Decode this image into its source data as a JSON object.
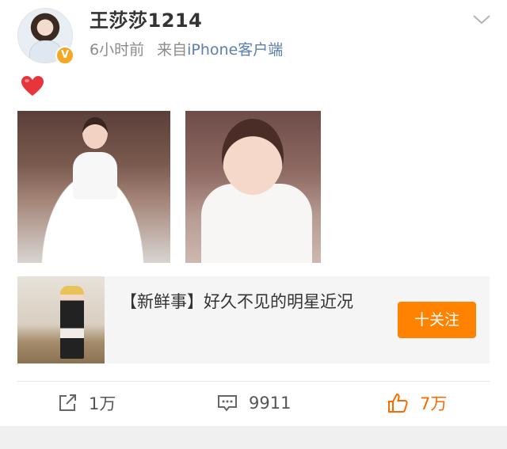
{
  "post": {
    "username": "王莎莎1214",
    "time": "6小时前",
    "source_prefix": "来自",
    "source": "iPhone客户端",
    "content_icon": "red-heart-emoji",
    "verified_icon": "verified-v-badge",
    "images": [
      "photo-1",
      "photo-2"
    ]
  },
  "card": {
    "title": "【新鲜事】好久不见的明星近况",
    "follow_label": "十关注"
  },
  "actions": {
    "repost_count": "1万",
    "comment_count": "9911",
    "like_count": "7万"
  },
  "colors": {
    "accent_orange": "#ff8200",
    "like_active": "#ff6a00",
    "verified_gold": "#f5a623",
    "meta_gray": "#8c8c8c"
  }
}
